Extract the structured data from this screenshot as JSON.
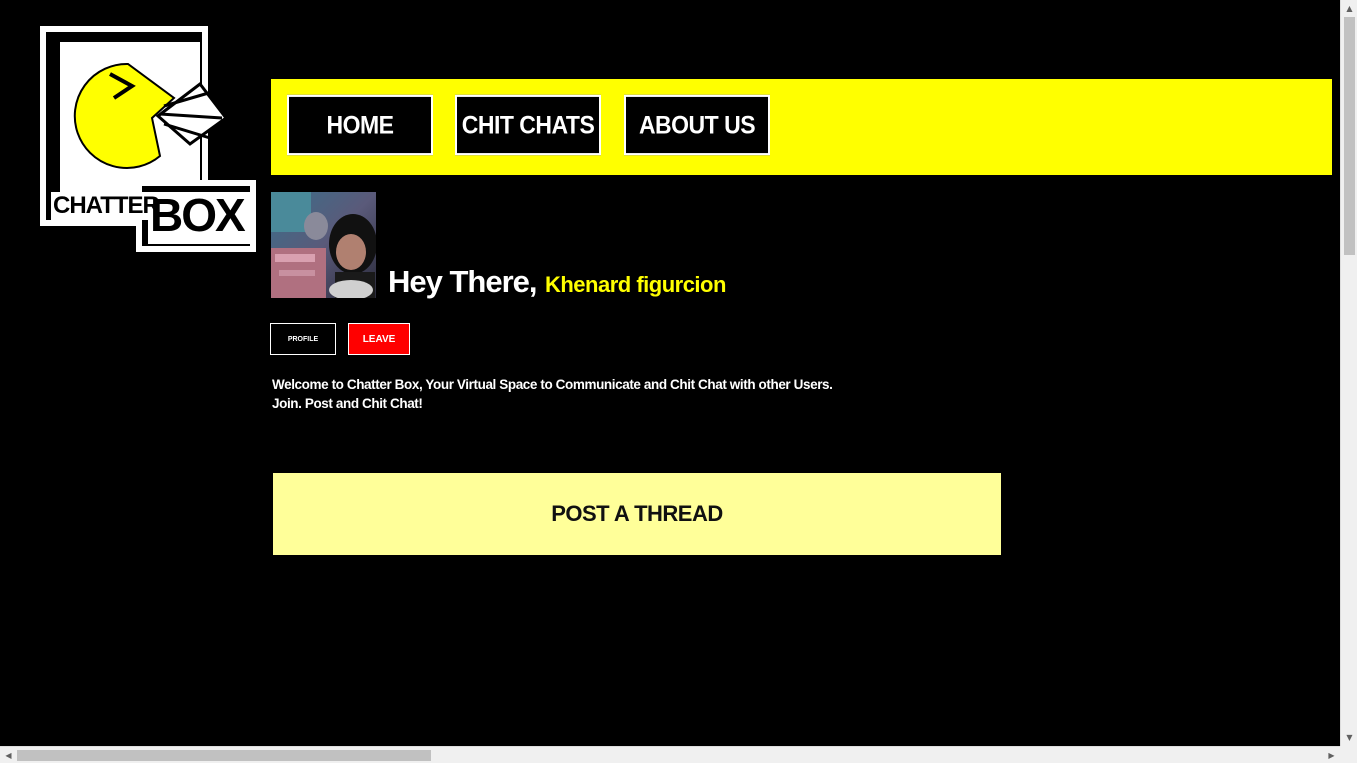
{
  "logo": {
    "word1": "CHATTER",
    "word2": "BOX",
    "icon": "pacman-chatter-icon",
    "mouth_symbol": ">",
    "colors": {
      "yellow": "#ffff00",
      "black": "#000000",
      "white": "#ffffff"
    }
  },
  "nav": {
    "items": [
      {
        "label": "HOME"
      },
      {
        "label": "CHIT CHATS"
      },
      {
        "label": "ABOUT US"
      }
    ],
    "background": "#ffff00"
  },
  "user": {
    "greeting": "Hey There,",
    "name": "Khenard figurcion",
    "avatar": "user-avatar-photo"
  },
  "actions": {
    "profile_label": "PROFILE",
    "leave_label": "LEAVE"
  },
  "welcome": {
    "line1": "Welcome to Chatter Box, Your Virtual Space to Communicate and Chit Chat with other Users.",
    "line2": "Join. Post and Chit Chat!"
  },
  "post_thread": {
    "label": "POST A THREAD",
    "background": "#ffff99"
  },
  "scrollbars": {
    "vertical": {
      "up_icon": "▲",
      "down_icon": "▼"
    },
    "horizontal": {
      "left_icon": "◀",
      "right_icon": "▶"
    }
  }
}
